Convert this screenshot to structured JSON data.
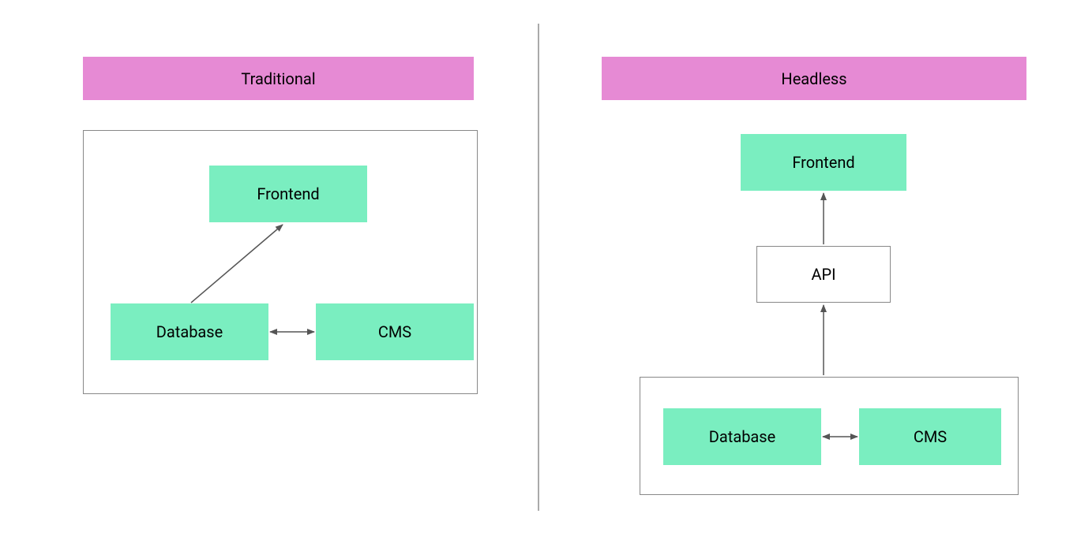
{
  "colors": {
    "pink": "#e68ad4",
    "mint": "#7aeec0",
    "white": "#ffffff",
    "black": "#000000",
    "gray": "#666666",
    "frame": "#888888"
  },
  "left": {
    "title": "Traditional",
    "boxes": {
      "frontend": "Frontend",
      "database": "Database",
      "cms": "CMS"
    }
  },
  "right": {
    "title": "Headless",
    "boxes": {
      "frontend": "Frontend",
      "api": "API",
      "database": "Database",
      "cms": "CMS"
    }
  }
}
